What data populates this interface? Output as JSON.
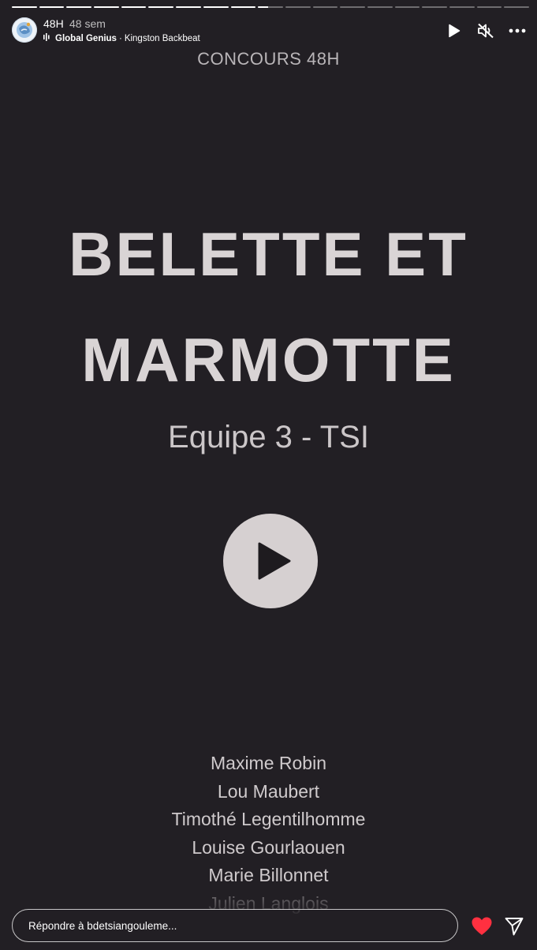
{
  "progress": {
    "segments_total": 19,
    "segments_completed": 9,
    "current_segment_fraction": 0.4
  },
  "header": {
    "account_name": "48H",
    "time_ago": "48 sem",
    "music": {
      "song": "Global Genius",
      "separator": "·",
      "artist": "Kingston Backbeat"
    },
    "controls": [
      "play-icon",
      "muted-speaker-icon",
      "more-icon"
    ]
  },
  "story": {
    "contest_label": "CONCOURS 48H",
    "title_line1": "BELETTE ET",
    "title_line2": "MARMOTTE",
    "team": "Equipe 3 - TSI",
    "members": [
      "Maxime Robin",
      "Lou Maubert",
      "Timothé Legentilhomme",
      "Louise Gourlaouen",
      "Marie Billonnet",
      "Julien Langlois"
    ]
  },
  "footer": {
    "reply_placeholder": "Répondre à bdetsiangouleme...",
    "like_color": "#ff3040"
  }
}
